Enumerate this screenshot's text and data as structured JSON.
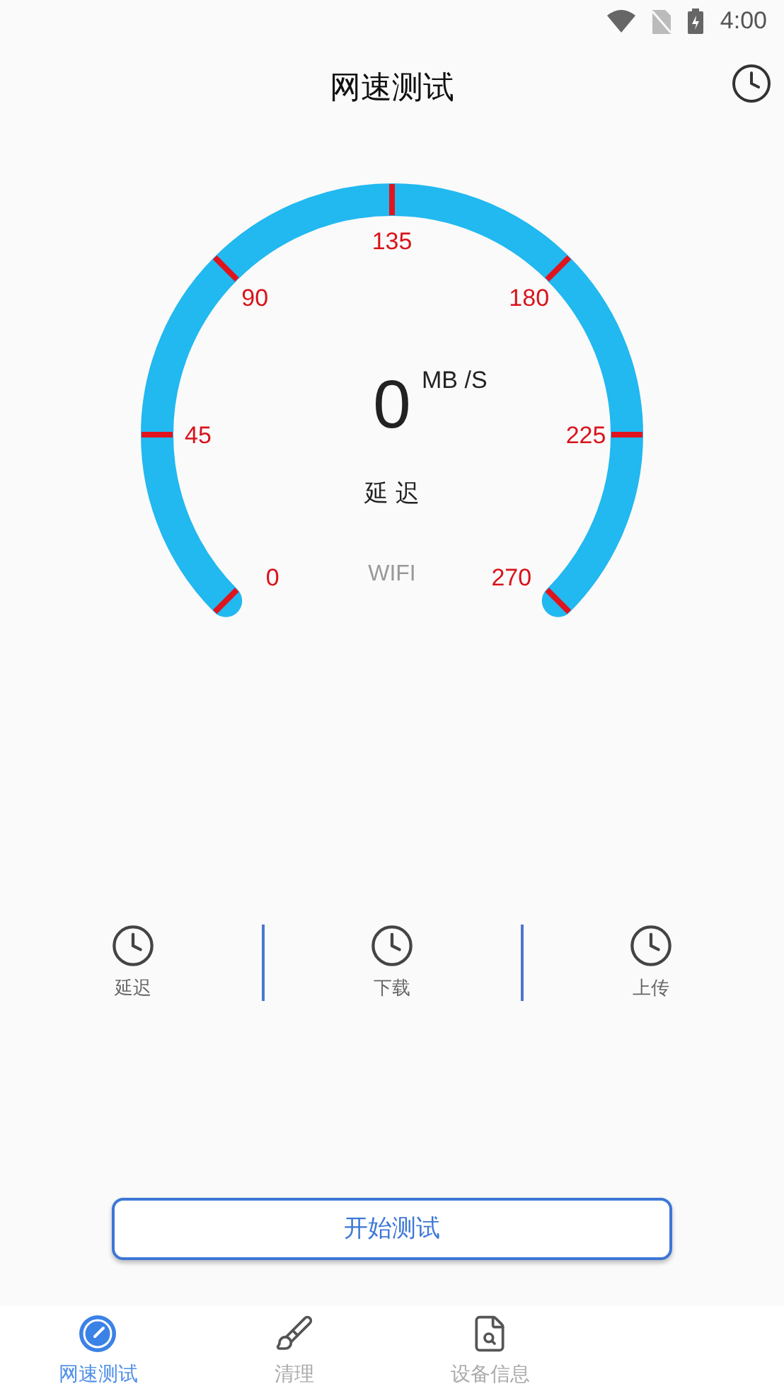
{
  "status_bar": {
    "time": "4:00"
  },
  "header": {
    "title": "网速测试"
  },
  "gauge": {
    "ticks": [
      "0",
      "45",
      "90",
      "135",
      "180",
      "225",
      "270"
    ],
    "value": "0",
    "unit": "MB /S",
    "metric": "延 迟",
    "network": "WIFI"
  },
  "stats": [
    {
      "label": "延迟"
    },
    {
      "label": "下载"
    },
    {
      "label": "上传"
    }
  ],
  "start_button": "开始测试",
  "nav": [
    {
      "kind": "speed",
      "label": "网速测试",
      "selected": true
    },
    {
      "kind": "clean",
      "label": "清理",
      "selected": false
    },
    {
      "kind": "device",
      "label": "设备信息",
      "selected": false
    }
  ]
}
